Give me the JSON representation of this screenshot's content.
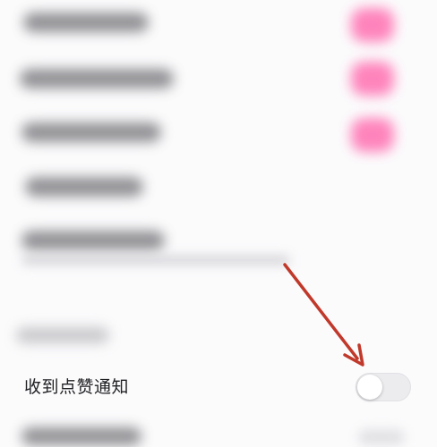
{
  "settings": {
    "like_notification": {
      "label": "收到点赞通知",
      "enabled": false
    }
  },
  "colors": {
    "accent_pink": "#ff6fb1",
    "arrow_red": "#c0392b",
    "toggle_off_bg": "#ececef",
    "background": "#fbfbfc"
  },
  "icons": {
    "annotation": "arrow-icon"
  }
}
